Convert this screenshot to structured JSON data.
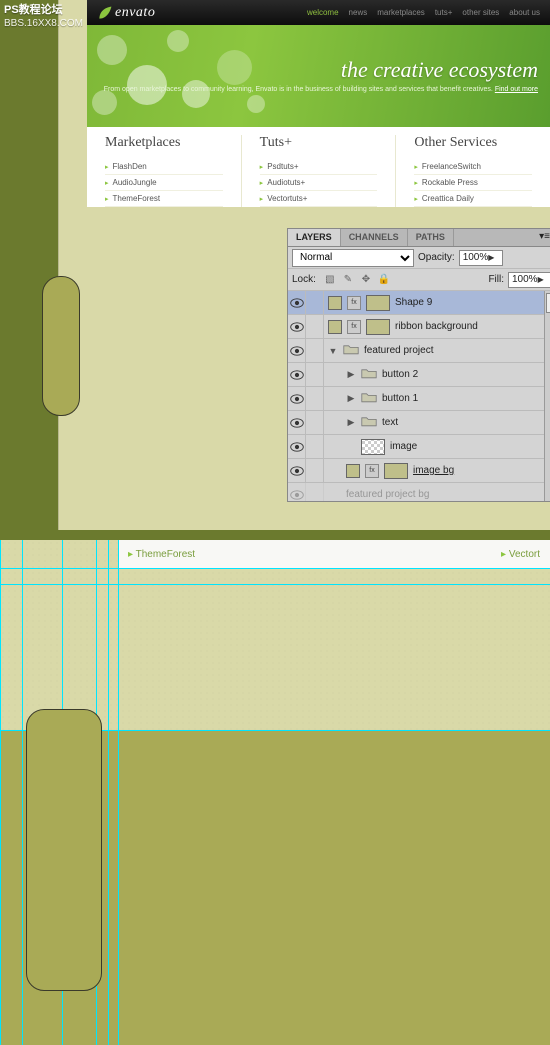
{
  "watermark": {
    "line1": "PS教程论坛",
    "line2": "BBS.16XX8.COM"
  },
  "site": {
    "logo": "envato",
    "nav": [
      {
        "label": "welcome",
        "active": true
      },
      {
        "label": "news"
      },
      {
        "label": "marketplaces"
      },
      {
        "label": "tuts+"
      },
      {
        "label": "other sites"
      },
      {
        "label": "about us"
      }
    ],
    "hero": {
      "title": "the creative ecosystem",
      "tagline": "From open marketplaces to community learning, Envato is in the business of\nbuilding sites and services that benefit creatives.",
      "link": "Find out more"
    },
    "columns": [
      {
        "title": "Marketplaces",
        "items": [
          "FlashDen",
          "AudioJungle",
          "ThemeForest"
        ]
      },
      {
        "title": "Tuts+",
        "items": [
          "Psdtuts+",
          "Audiotuts+",
          "Vectortuts+"
        ]
      },
      {
        "title": "Other Services",
        "items": [
          "FreelanceSwitch",
          "Rockable Press",
          "Creattica Daily"
        ]
      }
    ]
  },
  "layers_panel": {
    "tabs": [
      "LAYERS",
      "CHANNELS",
      "PATHS"
    ],
    "active_tab": "LAYERS",
    "blend_mode": "Normal",
    "opacity_label": "Opacity:",
    "opacity": "100%",
    "lock_label": "Lock:",
    "fill_label": "Fill:",
    "fill": "100%",
    "layers": [
      {
        "name": "Shape 9",
        "selected": true,
        "swatch": "#bfbf8a",
        "fx": true,
        "thumb": true,
        "indent": 0
      },
      {
        "name": "ribbon background",
        "swatch": "#bfbf8a",
        "fx": true,
        "thumb": true,
        "indent": 0
      },
      {
        "name": "featured project",
        "type": "group",
        "open": true,
        "indent": 0
      },
      {
        "name": "button 2",
        "type": "group",
        "open": false,
        "indent": 1
      },
      {
        "name": "button 1",
        "type": "group",
        "open": false,
        "indent": 1
      },
      {
        "name": "text",
        "type": "group",
        "open": false,
        "indent": 1
      },
      {
        "name": "image",
        "type": "mask",
        "indent": 1
      },
      {
        "name": "image bg",
        "swatch": "#bfbf8a",
        "fx": true,
        "thumb": true,
        "underline": true,
        "indent": 1
      },
      {
        "name": "featured project bg",
        "faded": true,
        "indent": 1
      }
    ]
  },
  "strip": {
    "left": "ThemeForest",
    "right": "Vectort"
  },
  "colors": {
    "olive": "#a9aa56",
    "cream": "#d9d9a8",
    "guide": "#00e5ff",
    "green": "#8cc63f"
  }
}
